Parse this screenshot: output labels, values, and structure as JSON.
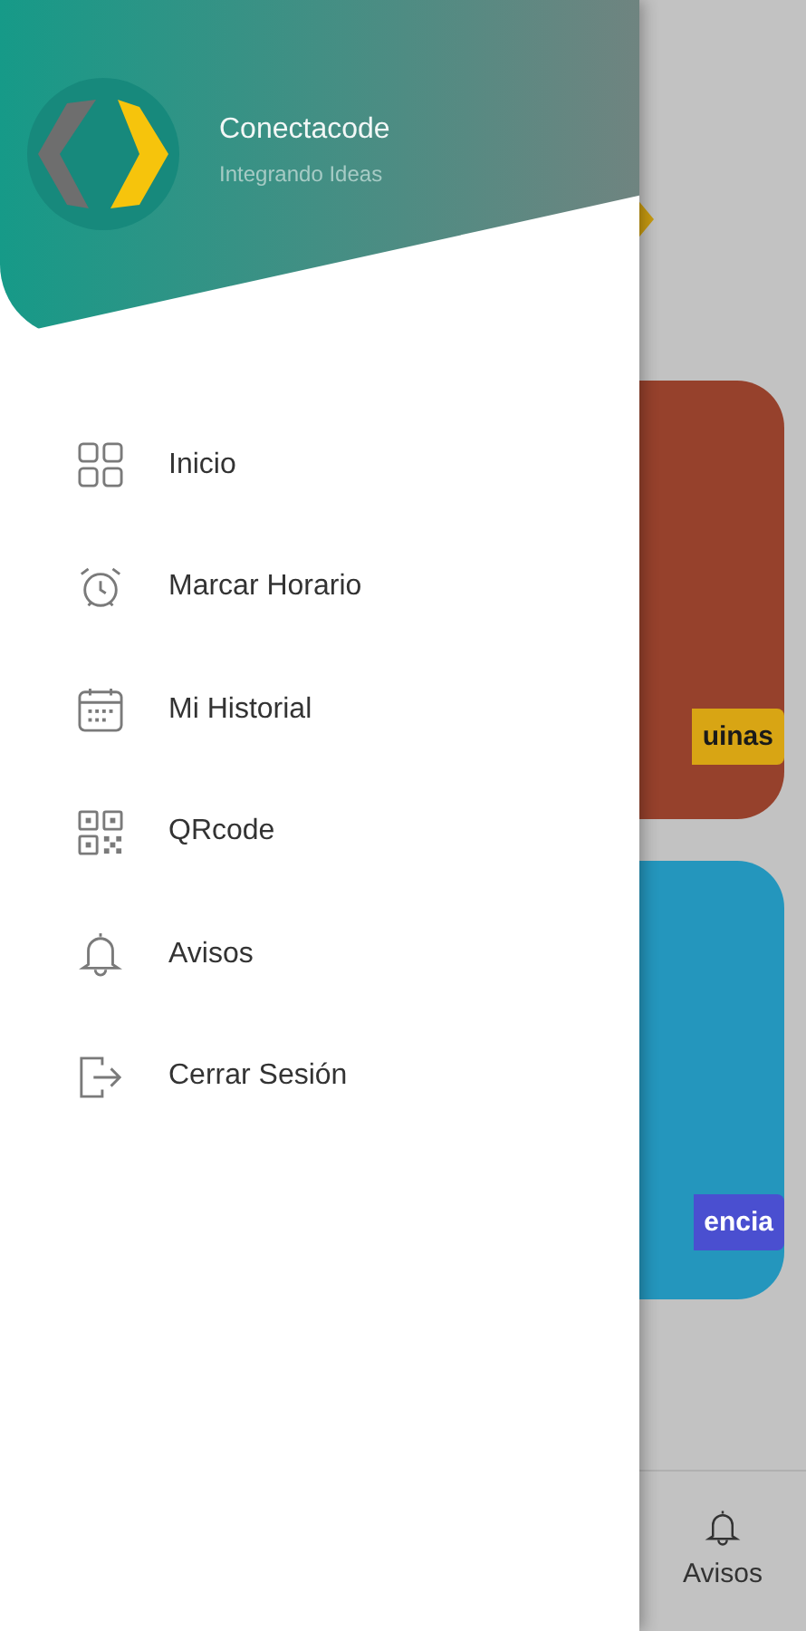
{
  "drawer": {
    "title": "Conectacode",
    "subtitle": "Integrando Ideas",
    "menu": [
      {
        "label": "Inicio",
        "kind": "grid"
      },
      {
        "label": "Marcar Horario",
        "kind": "alarm"
      },
      {
        "label": "Mi Historial",
        "kind": "calendar"
      },
      {
        "label": "QRcode",
        "kind": "qr"
      },
      {
        "label": "Avisos",
        "kind": "bell"
      },
      {
        "label": "Cerrar Sesión",
        "kind": "logout"
      }
    ]
  },
  "background": {
    "cards": [
      {
        "label": "uinas",
        "color": "#96412c"
      },
      {
        "label": "encia",
        "color": "#2496bd"
      }
    ],
    "bottom_nav": [
      {
        "label": "Avisos"
      }
    ]
  }
}
